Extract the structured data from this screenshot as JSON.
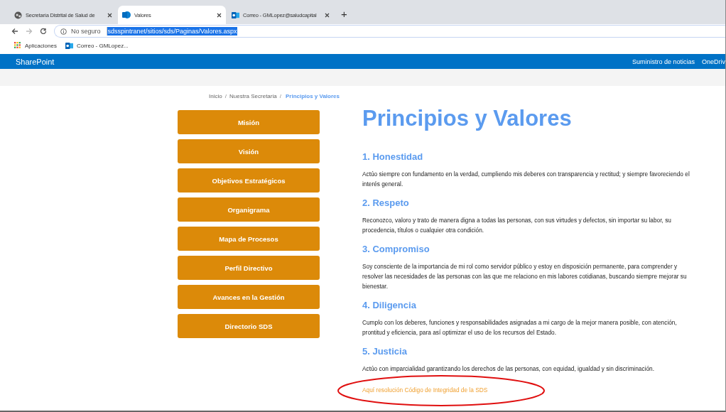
{
  "browser": {
    "tabs": [
      {
        "title": "Secretaría Distrital de Salud de",
        "selected": false
      },
      {
        "title": "Valores",
        "selected": true
      },
      {
        "title": "Correo - GMLopez@saludcapital",
        "selected": false
      }
    ],
    "new_tab": "+",
    "security": "No seguro",
    "url": "sdsspintranet/sitios/sds/Paginas/Valores.aspx",
    "bookmarks": [
      "Aplicaciones",
      "Correo - GMLopez..."
    ]
  },
  "suite_bar": {
    "brand": "SharePoint",
    "links": [
      "Suministro de noticias",
      "OneDriv"
    ]
  },
  "breadcrumb": [
    {
      "kind": "link",
      "label": "Inicio",
      "current": false
    },
    {
      "kind": "separator",
      "label": "/"
    },
    {
      "kind": "link",
      "label": "Nuestra Secretaria",
      "current": false
    },
    {
      "kind": "separator",
      "label": "/"
    },
    {
      "kind": "link",
      "label": "Principios y Valores",
      "current": true
    }
  ],
  "sidebar": {
    "items": [
      "Misión",
      "Visión",
      "Objetivos Estratégicos",
      "Organigrama",
      "Mapa de Procesos",
      "Perfil Directivo",
      "Avances en la Gestión",
      "Directorio SDS"
    ]
  },
  "page_title": "Principios y Valores",
  "sections": [
    {
      "heading": "1. Honestidad",
      "text": "Actúo siempre con fundamento en la verdad, cumpliendo mis deberes con transparencia y rectitud; y siempre favoreciendo el interés general."
    },
    {
      "heading": "2. Respeto",
      "text": "Reconozco, valoro y trato de manera digna a todas las personas, con sus virtudes y defectos, sin importar su labor, su procedencia, títulos o cualquier otra condición."
    },
    {
      "heading": "3. Compromiso",
      "text": "Soy consciente de la importancia de mi rol como servidor público y estoy en disposición permanente, para comprender y resolver las necesidades de las personas con las que me relaciono en mis labores cotidianas, buscando siempre mejorar su bienestar."
    },
    {
      "heading": "4. Diligencia",
      "text": "Cumplo con los deberes, funciones y responsabilidades asignadas a mi cargo de la mejor manera posible, con atención, prontitud y eficiencia, para así optimizar el uso de los recursos del Estado."
    },
    {
      "heading": "5. Justicia",
      "text": "Actúo con imparcialidad garantizando los derechos de las personas, con equidad, igualdad y sin discriminación."
    }
  ],
  "resolution_link": {
    "label": "Aquí resolución Código de Integridad de la SDS",
    "circled": true
  }
}
